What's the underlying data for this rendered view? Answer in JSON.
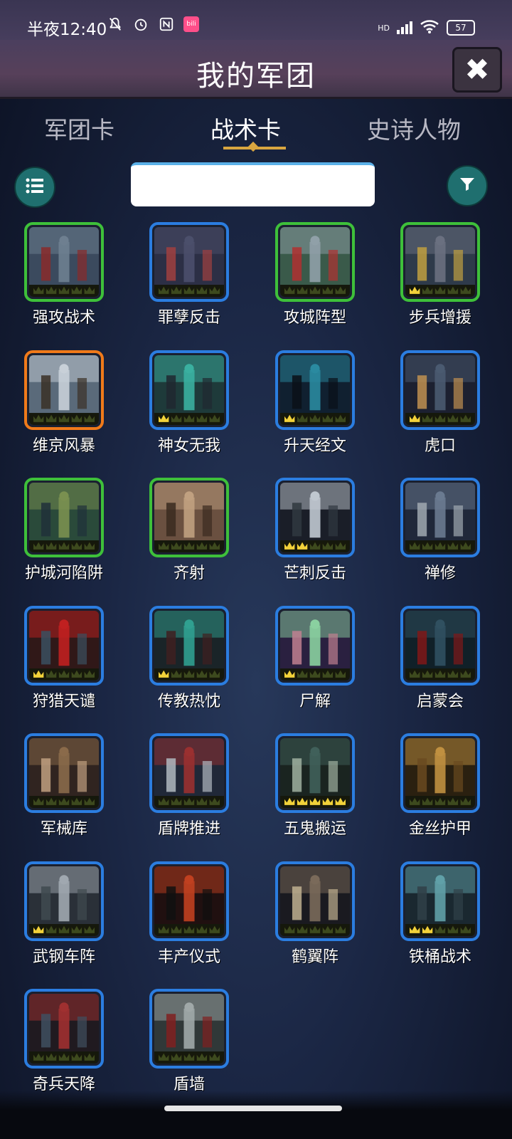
{
  "status_bar": {
    "time": "半夜12:40",
    "battery": "57",
    "network": "HD",
    "app_badge": "bili"
  },
  "header": {
    "title": "我的军团",
    "close_icon": "close-icon"
  },
  "tabs": [
    {
      "label": "军团卡",
      "active": false
    },
    {
      "label": "战术卡",
      "active": true
    },
    {
      "label": "史诗人物",
      "active": false
    }
  ],
  "search": {
    "value": "",
    "placeholder": ""
  },
  "colors": {
    "green_border": "#3ec03a",
    "blue_border": "#2b7de0",
    "orange_border": "#f07a1a",
    "tab_accent": "#d9a640",
    "button_teal": "#1f6f6f"
  },
  "cards": [
    {
      "name": "强攻战术",
      "rarity": "green",
      "stars": 0
    },
    {
      "name": "罪孽反击",
      "rarity": "blue",
      "stars": 0
    },
    {
      "name": "攻城阵型",
      "rarity": "green",
      "stars": 0
    },
    {
      "name": "步兵增援",
      "rarity": "green",
      "stars": 1
    },
    {
      "name": "维京风暴",
      "rarity": "orange",
      "stars": 0
    },
    {
      "name": "神女无我",
      "rarity": "blue",
      "stars": 1
    },
    {
      "name": "升天经文",
      "rarity": "blue",
      "stars": 1
    },
    {
      "name": "虎口",
      "rarity": "blue",
      "stars": 1
    },
    {
      "name": "护城河陷阱",
      "rarity": "green",
      "stars": 0
    },
    {
      "name": "齐射",
      "rarity": "green",
      "stars": 0
    },
    {
      "name": "芒刺反击",
      "rarity": "blue",
      "stars": 2
    },
    {
      "name": "禅修",
      "rarity": "blue",
      "stars": 0
    },
    {
      "name": "狩猎天谴",
      "rarity": "blue",
      "stars": 1
    },
    {
      "name": "传教热忱",
      "rarity": "blue",
      "stars": 1
    },
    {
      "name": "尸解",
      "rarity": "blue",
      "stars": 1
    },
    {
      "name": "启蒙会",
      "rarity": "blue",
      "stars": 0
    },
    {
      "name": "军械库",
      "rarity": "blue",
      "stars": 0
    },
    {
      "name": "盾牌推进",
      "rarity": "blue",
      "stars": 0
    },
    {
      "name": "五鬼搬运",
      "rarity": "blue",
      "stars": 5
    },
    {
      "name": "金丝护甲",
      "rarity": "blue",
      "stars": 0
    },
    {
      "name": "武钢车阵",
      "rarity": "blue",
      "stars": 1
    },
    {
      "name": "丰产仪式",
      "rarity": "blue",
      "stars": 0
    },
    {
      "name": "鹤翼阵",
      "rarity": "blue",
      "stars": 0
    },
    {
      "name": "铁桶战术",
      "rarity": "blue",
      "stars": 2
    },
    {
      "name": "奇兵天降",
      "rarity": "blue",
      "stars": 0
    },
    {
      "name": "盾墙",
      "rarity": "blue",
      "stars": 0
    }
  ]
}
